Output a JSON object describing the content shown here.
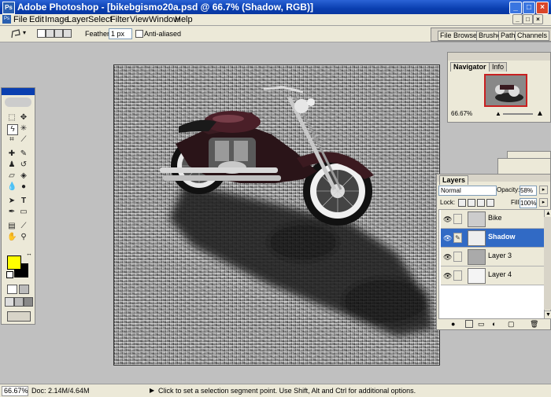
{
  "window": {
    "title": "Adobe Photoshop - [bikebgismo20a.psd @ 66.7% (Shadow, RGB)]"
  },
  "menu": [
    "File",
    "Edit",
    "Image",
    "Layer",
    "Select",
    "Filter",
    "View",
    "Window",
    "Help"
  ],
  "options": {
    "feather_label": "Feather:",
    "feather_value": "1 px",
    "antialias_label": "Anti-aliased"
  },
  "palette_well": [
    "File Browser",
    "Brushes",
    "Paths",
    "Channels"
  ],
  "navigator": {
    "tabs": [
      "Navigator",
      "Info"
    ],
    "zoom": "66.67%"
  },
  "layers": {
    "tab": "Layers",
    "blend_mode": "Normal",
    "opacity_label": "Opacity:",
    "opacity": "58%",
    "lock_label": "Lock:",
    "fill_label": "Fill:",
    "fill": "100%",
    "items": [
      {
        "name": "Bike"
      },
      {
        "name": "Shadow"
      },
      {
        "name": "Layer 3"
      },
      {
        "name": "Layer 4"
      }
    ]
  },
  "status": {
    "zoom": "66.67%",
    "doc": "Doc: 2.14M/4.64M",
    "hint": "Click to set a selection segment point. Use Shift, Alt and Ctrl for additional options."
  },
  "colors": {
    "foreground": "#ffff00",
    "background": "#000000",
    "title_bar": "#0a3fb0",
    "selected_layer": "#316ac5"
  },
  "icons": [
    "photoshop-logo-icon",
    "minimize-icon",
    "maximize-icon",
    "close-icon",
    "lasso-icon",
    "eye-icon",
    "brush-link-icon"
  ]
}
